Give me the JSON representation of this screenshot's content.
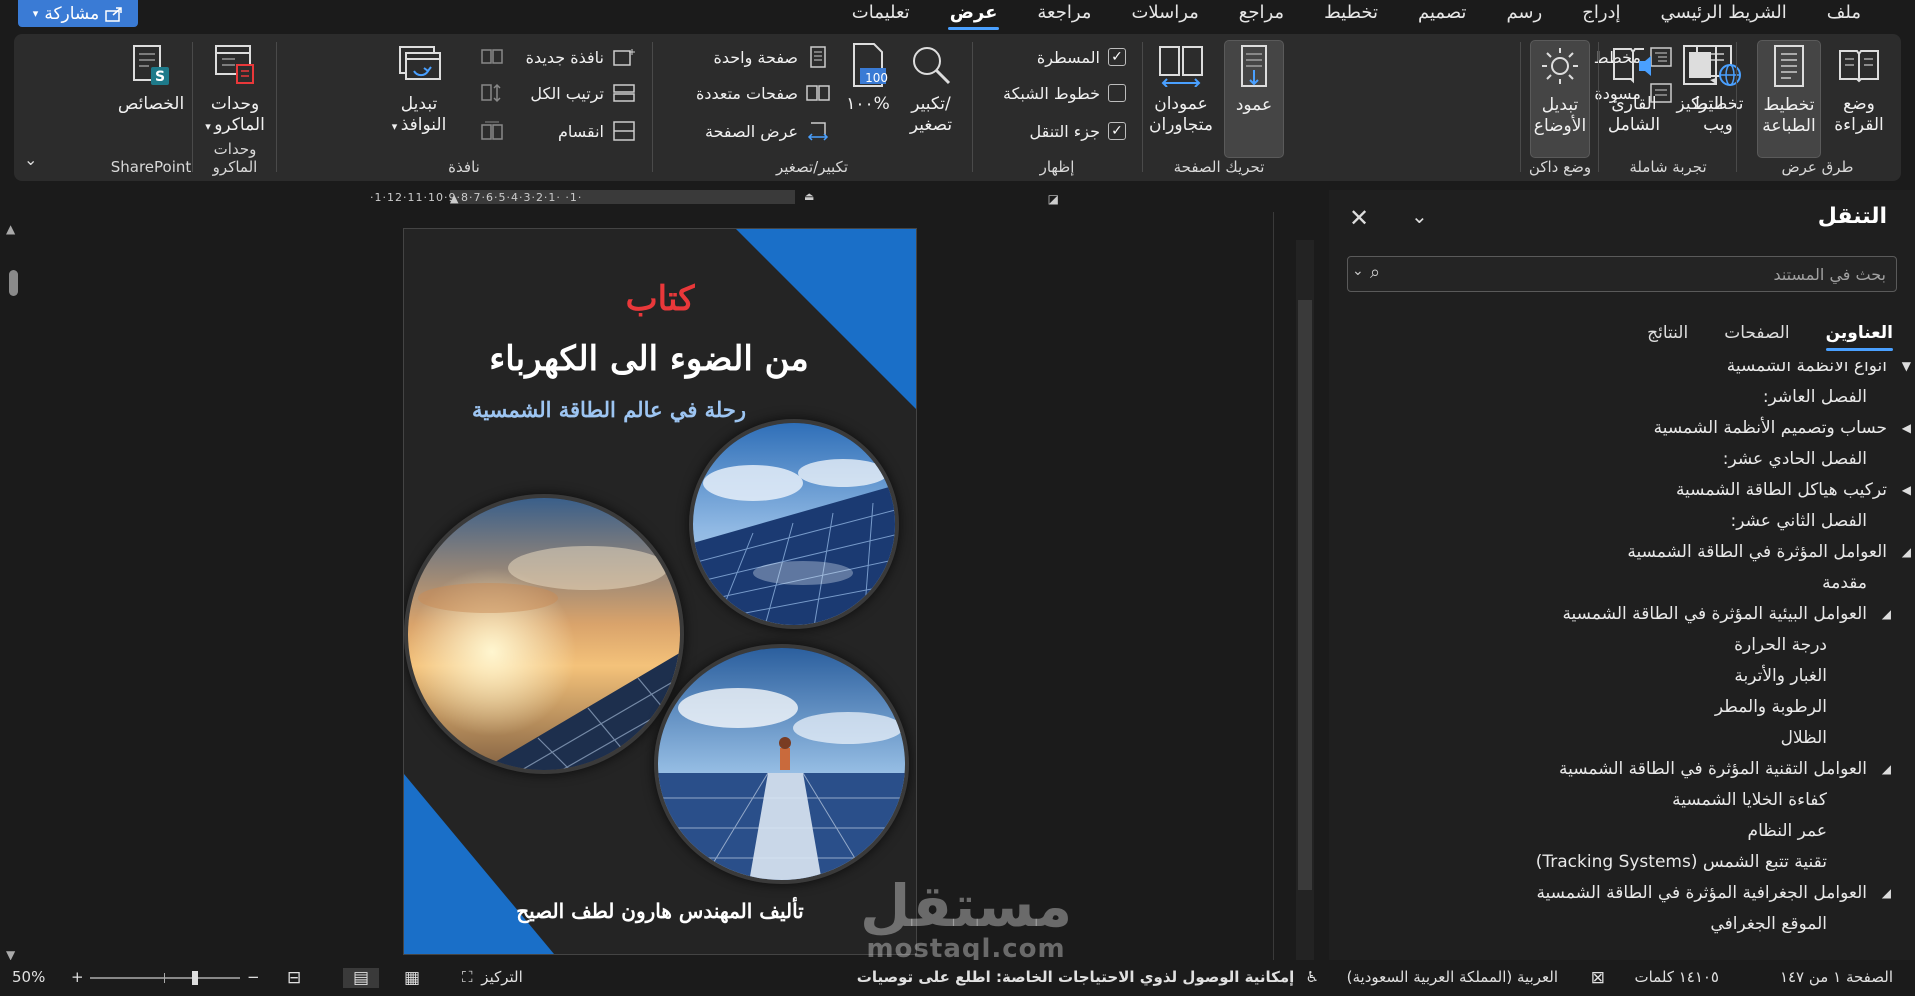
{
  "menubar": {
    "share_label": "مشاركة",
    "tabs": [
      "ملف",
      "الشريط الرئيسي",
      "إدراج",
      "رسم",
      "تصميم",
      "تخطيط",
      "مراجع",
      "مراسلات",
      "مراجعة",
      "عرض",
      "تعليمات"
    ],
    "active_tab": "عرض"
  },
  "ribbon": {
    "groups": {
      "views": "طرق عرض",
      "immersive": "تجربة شاملة",
      "dark": "وضع داكن",
      "page_move": "تحريك الصفحة",
      "show": "إظهار",
      "zoom": "تكبير/تصغير",
      "window": "نافذة",
      "macros": "وحدات الماكرو",
      "sharepoint": "SharePoint"
    },
    "views": {
      "read_mode": [
        "وضع",
        "القراءة"
      ],
      "print_layout": [
        "تخطيط",
        "الطباعة"
      ],
      "web_layout": [
        "تخطيط",
        "ويب"
      ],
      "outline": "مخطط تفصيلي",
      "draft": "مسودة"
    },
    "immersive": {
      "focus": "التركيز",
      "reader": [
        "القارئ",
        "الشامل"
      ]
    },
    "dark": {
      "switch_modes": [
        "تبديل",
        "الأوضاع"
      ]
    },
    "page_move": {
      "vertical": "عمود",
      "side_by_side": [
        "عمودان",
        "متجاوران"
      ]
    },
    "show": {
      "ruler": "المسطرة",
      "gridlines": "خطوط الشبكة",
      "nav_pane": "جزء التنقل"
    },
    "show_state": {
      "ruler": true,
      "gridlines": false,
      "nav_pane": true
    },
    "zoom": {
      "zoom": [
        "تكبير/",
        "تصغير"
      ],
      "hundred": "١٠٠%",
      "hundred_icon": "100",
      "one_page": "صفحة واحدة",
      "multi_page": "صفحات متعددة",
      "page_width": "عرض الصفحة"
    },
    "window": {
      "new_window": "نافذة جديدة",
      "arrange_all": "ترتيب الكل",
      "split": "انقسام",
      "switch_windows": [
        "تبديل",
        "النوافذ"
      ]
    },
    "macros": {
      "macros": [
        "وحدات",
        "الماكرو"
      ]
    },
    "sharepoint": {
      "properties": "الخصائص"
    }
  },
  "nav": {
    "title": "التنقل",
    "search_placeholder": "بحث في المستند",
    "tabs": [
      "العناوين",
      "الصفحات",
      "النتائج"
    ],
    "active_tab": "العناوين",
    "headings": [
      {
        "text": "أنواع الأنظمة الشمسية",
        "level": 1,
        "expander": "▼"
      },
      {
        "text": "الفصل العاشر:",
        "level": 0,
        "expander": ""
      },
      {
        "text": "حساب وتصميم الأنظمة الشمسية",
        "level": 1,
        "expander": "◀"
      },
      {
        "text": "الفصل الحادي عشر:",
        "level": 0,
        "expander": ""
      },
      {
        "text": "تركيب هياكل الطاقة الشمسية",
        "level": 1,
        "expander": "◀"
      },
      {
        "text": "الفصل الثاني عشر:",
        "level": 0,
        "expander": ""
      },
      {
        "text": "العوامل المؤثرة في الطاقة الشمسية",
        "level": 1,
        "expander": "◢"
      },
      {
        "text": "مقدمة",
        "level": 2,
        "expander": ""
      },
      {
        "text": "العوامل البيئية المؤثرة في الطاقة الشمسية",
        "level": 2,
        "expander": "◢"
      },
      {
        "text": "درجة الحرارة",
        "level": 3,
        "expander": ""
      },
      {
        "text": "الغبار والأتربة",
        "level": 3,
        "expander": ""
      },
      {
        "text": "الرطوبة والمطر",
        "level": 3,
        "expander": ""
      },
      {
        "text": "الظلال",
        "level": 3,
        "expander": ""
      },
      {
        "text": "العوامل التقنية المؤثرة في الطاقة الشمسية",
        "level": 2,
        "expander": "◢"
      },
      {
        "text": "كفاءة الخلايا الشمسية",
        "level": 3,
        "expander": ""
      },
      {
        "text": "عمر النظام",
        "level": 3,
        "expander": ""
      },
      {
        "text": "تقنية تتبع الشمس (Tracking Systems)",
        "level": 3,
        "expander": ""
      },
      {
        "text": "العوامل الجغرافية المؤثرة في الطاقة الشمسية",
        "level": 2,
        "expander": "◢"
      },
      {
        "text": "الموقع الجغرافي",
        "level": 3,
        "expander": ""
      }
    ]
  },
  "document": {
    "book_label": "كتاب",
    "title": "من الضوء الى الكهرباء",
    "subtitle": "رحلة في عالم الطاقة الشمسية",
    "author": "تأليف المهندس هارون لطف الصيح",
    "ruler_numbers": "·1·12·11·10·9·8·7·6·5·4·3·2·1· ·1·"
  },
  "watermark": {
    "arabic": "مستقل",
    "latin": "mostaql.com"
  },
  "status": {
    "page": "الصفحة ١ من ١٤٧",
    "words": "١٤١٠٥ كلمات",
    "language": "العربية (المملكة العربية السعودية)",
    "accessibility": "إمكانية الوصول لذوي الاحتياجات الخاصة: اطلع على توصيات",
    "focus": "التركيز",
    "zoom": "50%",
    "zoom_level": 0.5
  },
  "colors": {
    "accent": "#4aa0ff",
    "share": "#3a7bd5",
    "book_red": "#e9383a",
    "book_blue": "#1a6fc8",
    "subtitle_blue": "#9dc5f2"
  }
}
